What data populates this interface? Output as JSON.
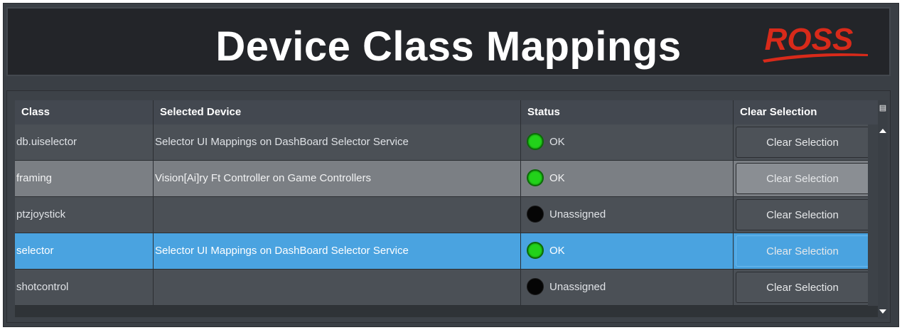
{
  "header": {
    "title": "Device Class Mappings",
    "logo_text": "ROSS",
    "logo_color": "#d82a1a"
  },
  "table": {
    "columns": [
      "Class",
      "Selected Device",
      "Status",
      "Clear Selection"
    ],
    "rows": [
      {
        "class": "db.uiselector",
        "device": "Selector UI Mappings on DashBoard Selector Service",
        "status": "OK",
        "status_icon": "green-status-icon",
        "button": "Clear Selection",
        "style": "dark"
      },
      {
        "class": "framing",
        "device": "Vision[Ai]ry Ft Controller on Game Controllers",
        "status": "OK",
        "status_icon": "green-status-icon",
        "button": "Clear Selection",
        "style": "light"
      },
      {
        "class": "ptzjoystick",
        "device": "",
        "status": "Unassigned",
        "status_icon": "black-status-icon",
        "button": "Clear Selection",
        "style": "dark"
      },
      {
        "class": "selector",
        "device": "Selector UI Mappings on DashBoard Selector Service",
        "status": "OK",
        "status_icon": "green-status-icon",
        "button": "Clear Selection",
        "style": "selected"
      },
      {
        "class": "shotcontrol",
        "device": "",
        "status": "Unassigned",
        "status_icon": "black-status-icon",
        "button": "Clear Selection",
        "style": "dark"
      }
    ]
  },
  "colors": {
    "selected_row": "#4aa3e0",
    "ok_status": "#22d21a",
    "unassigned_status": "#050505",
    "header_bg": "#232529"
  }
}
